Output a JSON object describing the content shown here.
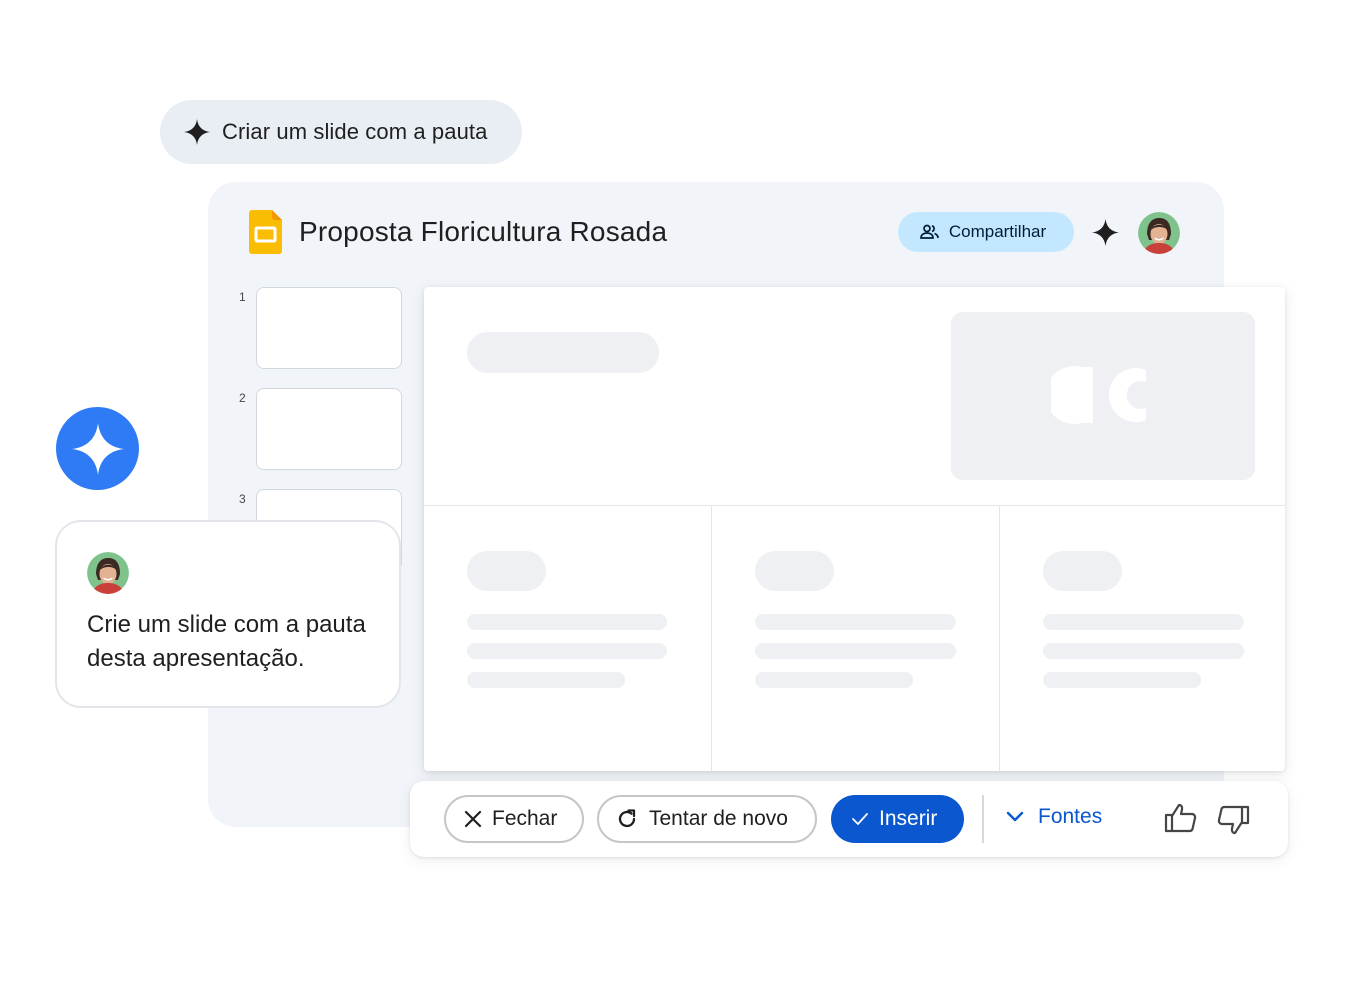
{
  "prompt_chip": {
    "label": "Criar um slide com a pauta",
    "icon": "sparkle-icon"
  },
  "app": {
    "title": "Proposta Floricultura Rosada",
    "share_label": "Compartilhar",
    "slides_icon_color": "#fbbc04",
    "thumbnails": [
      "1",
      "2",
      "3"
    ]
  },
  "chat": {
    "message": "Crie um slide com a pauta desta apresentação."
  },
  "actions": {
    "close_label": "Fechar",
    "retry_label": "Tentar de novo",
    "insert_label": "Inserir",
    "sources_label": "Fontes"
  },
  "colors": {
    "accent": "#0b57d0",
    "share_bg": "#c2e7ff",
    "gemini_blue": "#2f7bf5",
    "window_bg": "#f1f4f9",
    "chip_bg": "#e9edf4"
  }
}
